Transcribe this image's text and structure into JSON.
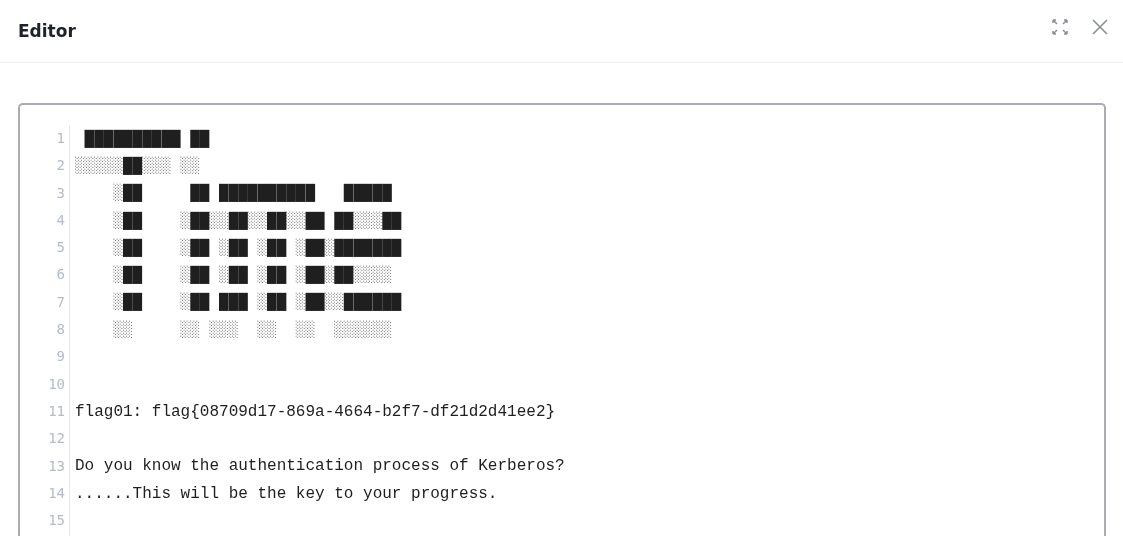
{
  "dialog": {
    "title": "Editor"
  },
  "editor": {
    "lines": [
      {
        "number": "1",
        "text": " ██████████ ██"
      },
      {
        "number": "2",
        "text": "░░░░░██░░░ ░░"
      },
      {
        "number": "3",
        "text": "    ░██     ██ ██████████   █████"
      },
      {
        "number": "4",
        "text": "    ░██    ░██░░██░░██░░██ ██░░░██"
      },
      {
        "number": "5",
        "text": "    ░██    ░██ ░██ ░██ ░██░███████"
      },
      {
        "number": "6",
        "text": "    ░██    ░██ ░██ ░██ ░██░██░░░░"
      },
      {
        "number": "7",
        "text": "    ░██    ░██ ███ ░██ ░██░░██████"
      },
      {
        "number": "8",
        "text": "    ░░     ░░ ░░░  ░░  ░░  ░░░░░░"
      },
      {
        "number": "9"
      },
      {
        "number": "10"
      },
      {
        "number": "11",
        "text": "flag01: flag{08709d17-869a-4664-b2f7-df21d2d41ee2}"
      },
      {
        "number": "12"
      },
      {
        "number": "13",
        "text": "Do you know the authentication process of Kerberos?"
      },
      {
        "number": "14",
        "text": "......This will be the key to your progress."
      },
      {
        "number": "15"
      }
    ]
  }
}
